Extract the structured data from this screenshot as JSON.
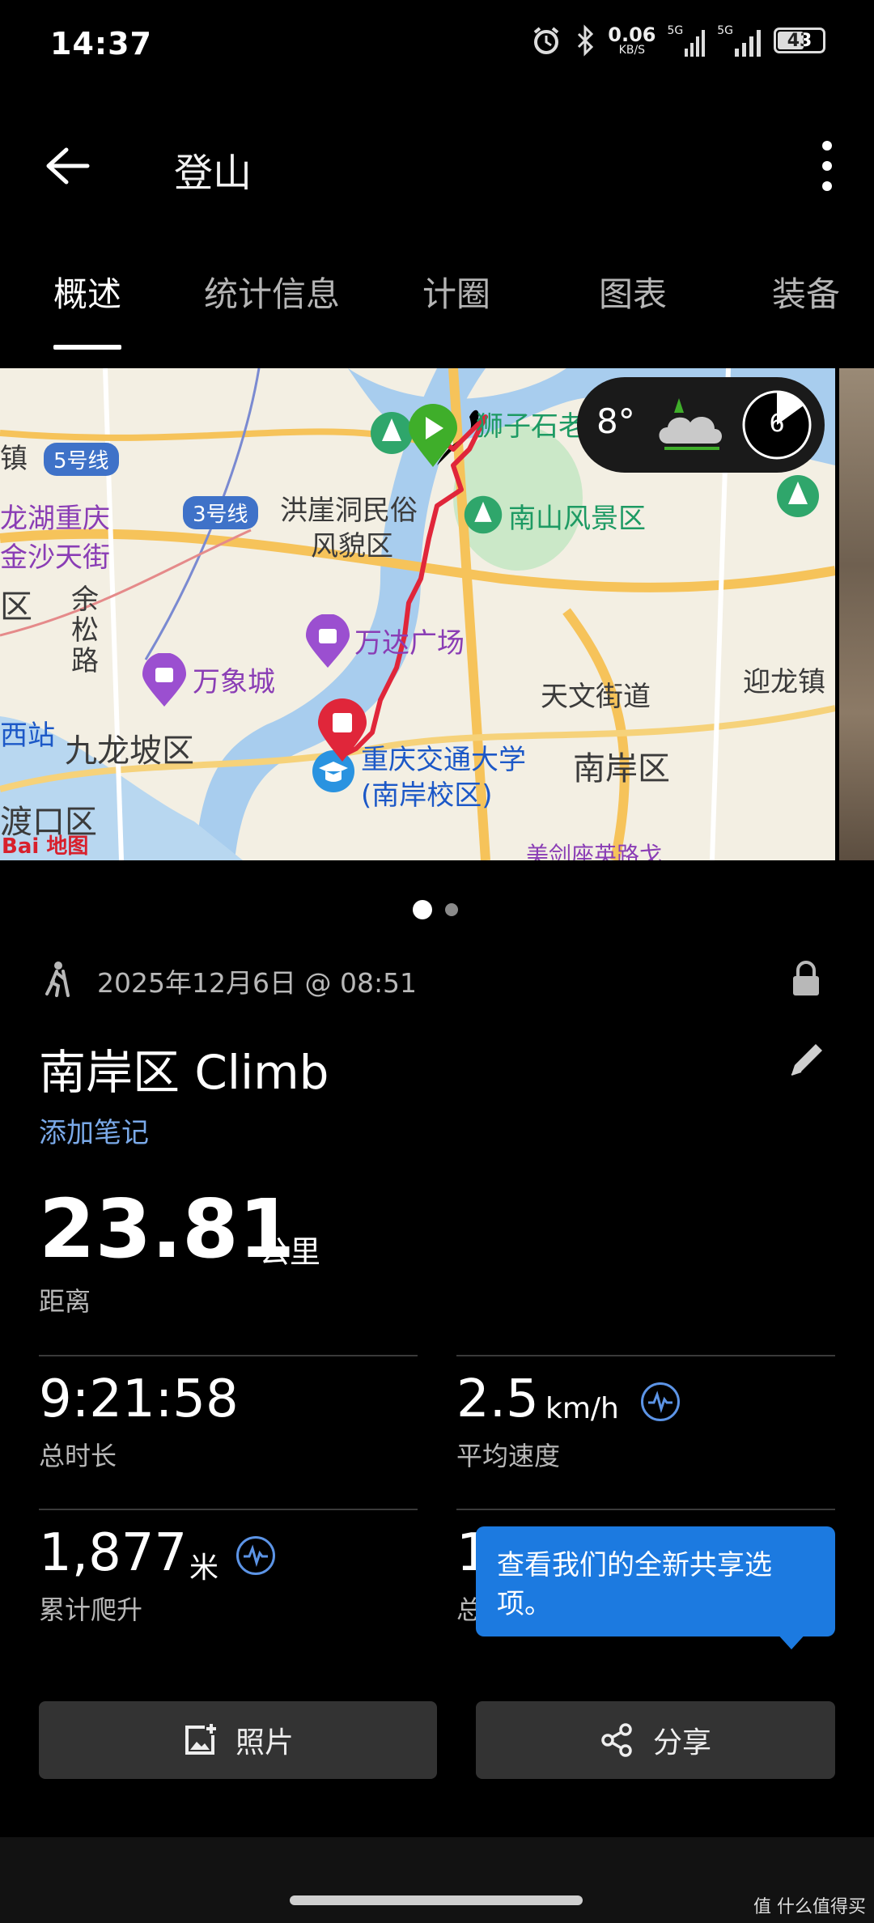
{
  "status_bar": {
    "time": "14:37",
    "net_speed": "0.06",
    "net_unit": "KB/S",
    "sim1": "5G",
    "sim2": "5G",
    "battery": "43"
  },
  "header": {
    "title": "登山"
  },
  "tabs": [
    {
      "label": "概述",
      "active": true
    },
    {
      "label": "统计信息",
      "active": false
    },
    {
      "label": "计圈",
      "active": false
    },
    {
      "label": "图表",
      "active": false
    },
    {
      "label": "装备",
      "active": false
    }
  ],
  "map": {
    "labels": {
      "l1": "狮子石老街",
      "l2": "南山风景区",
      "l3": "洪崖洞民俗",
      "l4": "风貌区",
      "l5": "龙湖重庆",
      "l6": "金沙天街",
      "l7": "万达广场",
      "l8": "万象城",
      "l9": "天文街道",
      "l10": "迎龙镇",
      "l11": "南岸区",
      "l12": "九龙坡区",
      "l13": "重庆交通大学",
      "l14": "(南岸校区)",
      "l15": "余",
      "l16": "松",
      "l17": "路",
      "l18": "渡口区",
      "l19": "西站",
      "l20": "区",
      "l21": "镇",
      "l22": "美剑座英路戈"
    },
    "line_badges": {
      "b1": "5号线",
      "b2": "3号线"
    },
    "logo": "Bai 地图",
    "weather": {
      "temp": "8°",
      "uv_index": "6"
    }
  },
  "pager": {
    "count": 2,
    "active": 0
  },
  "activity": {
    "datetime": "2025年12月6日 @ 08:51",
    "title": "南岸区 Climb",
    "add_note": "添加笔记",
    "distance": {
      "value": "23.81",
      "unit": "公里",
      "label": "距离"
    },
    "stats": {
      "total_time": {
        "value": "9:21:58",
        "label": "总时长"
      },
      "avg_speed": {
        "value": "2.5",
        "unit": "km/h",
        "label": "平均速度"
      },
      "ascent": {
        "value": "1,877",
        "unit": "米",
        "label": "累计爬升"
      },
      "partial_value": "1",
      "partial_label": "总"
    }
  },
  "tooltip": {
    "text": "查看我们的全新共享选项。"
  },
  "buttons": {
    "photos": "照片",
    "share": "分享"
  },
  "watermark": "值 什么值得买"
}
